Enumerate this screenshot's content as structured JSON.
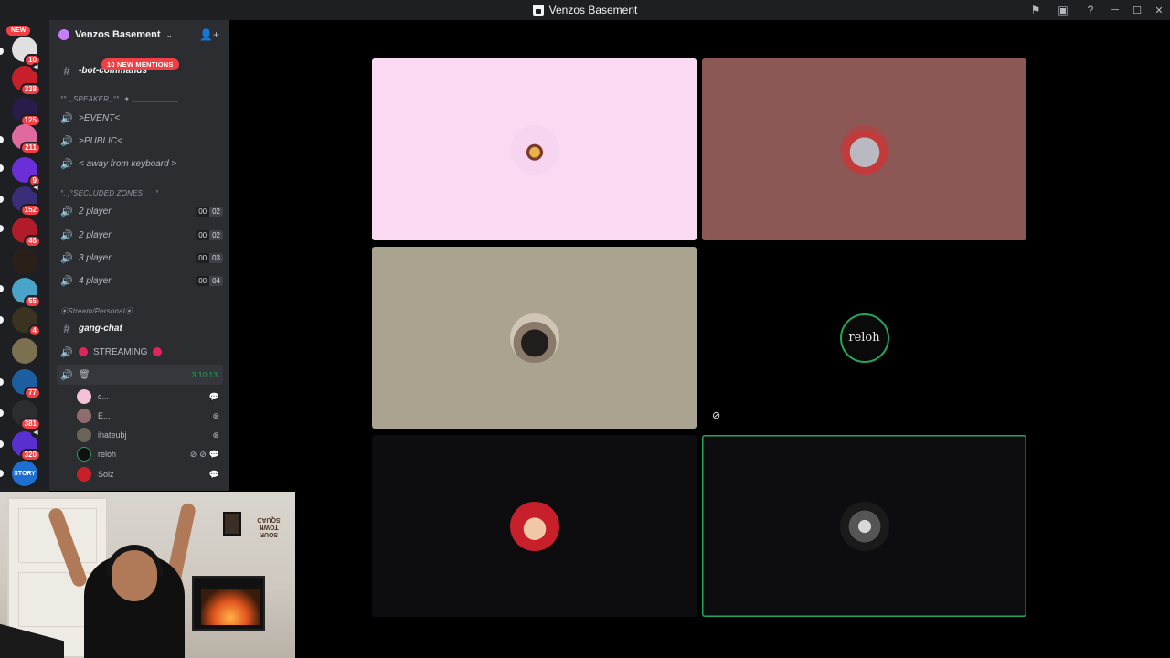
{
  "window": {
    "title": "Venzos Basement"
  },
  "rail": {
    "new_label": "NEW",
    "servers": [
      {
        "name": "server-1",
        "badge": "10",
        "color": "#e0e0e0"
      },
      {
        "name": "server-2",
        "badge": "338",
        "color": "#c8202a"
      },
      {
        "name": "server-3",
        "badge": "125",
        "color": "#2a1c4a"
      },
      {
        "name": "server-4",
        "badge": "211",
        "color": "#e06aa0"
      },
      {
        "name": "server-5",
        "badge": "9",
        "color": "#6a2fd6"
      },
      {
        "name": "server-6",
        "badge": "152",
        "color": "#3a2d7a"
      },
      {
        "name": "server-7",
        "badge": "46",
        "color": "#b01c2a"
      },
      {
        "name": "server-8",
        "badge": "",
        "color": "#2b2018"
      },
      {
        "name": "server-9",
        "badge": "55",
        "color": "#4aa3c9"
      },
      {
        "name": "server-10",
        "badge": "4",
        "color": "#3a3320"
      },
      {
        "name": "server-11",
        "badge": "",
        "color": "#7b7050"
      },
      {
        "name": "server-12",
        "badge": "77",
        "color": "#1c5fa0"
      },
      {
        "name": "server-13",
        "badge": "381",
        "color": "#2b2d31"
      },
      {
        "name": "server-14",
        "badge": "320",
        "color": "#5a2fd0"
      },
      {
        "name": "server-15",
        "badge": "",
        "color": "#1e6fd0"
      }
    ],
    "story_label": "STORY"
  },
  "sidebar": {
    "guild_name": "Venzos Basement",
    "mentions_pill": "10 NEW MENTIONS",
    "channels": {
      "bot_commands": "-bot-commands",
      "cat_speaker": "°° _SPEAKER_°°. ✦ ___________",
      "event": ">EVENT<",
      "public": ">PUBLIC<",
      "afk": "< away from keyboard >",
      "cat_secluded": "°. ̯.°SECLUDED ZONES___°",
      "two_player_a": "2 player",
      "two_player_a_counts": [
        "00",
        "02"
      ],
      "two_player_b": "2 player",
      "two_player_b_counts": [
        "00",
        "02"
      ],
      "three_player": "3 player",
      "three_player_counts": [
        "00",
        "03"
      ],
      "four_player": "4 player",
      "four_player_counts": [
        "00",
        "04"
      ],
      "cat_stream": "⦿Stream/Personal⦿",
      "gang_chat": "gang-chat",
      "streaming": "STREAMING",
      "active_voice": "🗑",
      "active_timer": "3:10:13"
    },
    "voice_users": [
      {
        "name": "c...",
        "color": "#f3c2d8"
      },
      {
        "name": "E...",
        "color": "#8f6d6d"
      },
      {
        "name": "ihateubj",
        "color": "#6a6358"
      },
      {
        "name": "reloh",
        "color": "#111111"
      },
      {
        "name": "Solz",
        "color": "#c8202a"
      }
    ]
  },
  "webcam": {
    "sign_text": "SOUR TOWN SQUAD"
  },
  "stage": {
    "tiles": [
      {
        "name": "tile-1",
        "bg": "#fcd9f3",
        "avatar": "#f7d4ef"
      },
      {
        "name": "tile-2",
        "bg": "#8b5856",
        "avatar": "#d4d4d8"
      },
      {
        "name": "tile-3",
        "bg": "#aaa390",
        "avatar": "#3b3434"
      },
      {
        "name": "tile-4",
        "bg": "#000000",
        "avatar": "#0a0a0a"
      },
      {
        "name": "tile-5",
        "bg": "#0d0d10",
        "avatar": "#c8202a"
      },
      {
        "name": "tile-6",
        "bg": "#0d0d10",
        "avatar": "#3a3a3a"
      }
    ],
    "reloh_logo": "reloh"
  },
  "colors": {
    "accent_green": "#23a55a",
    "mention_red": "#f23f43"
  }
}
